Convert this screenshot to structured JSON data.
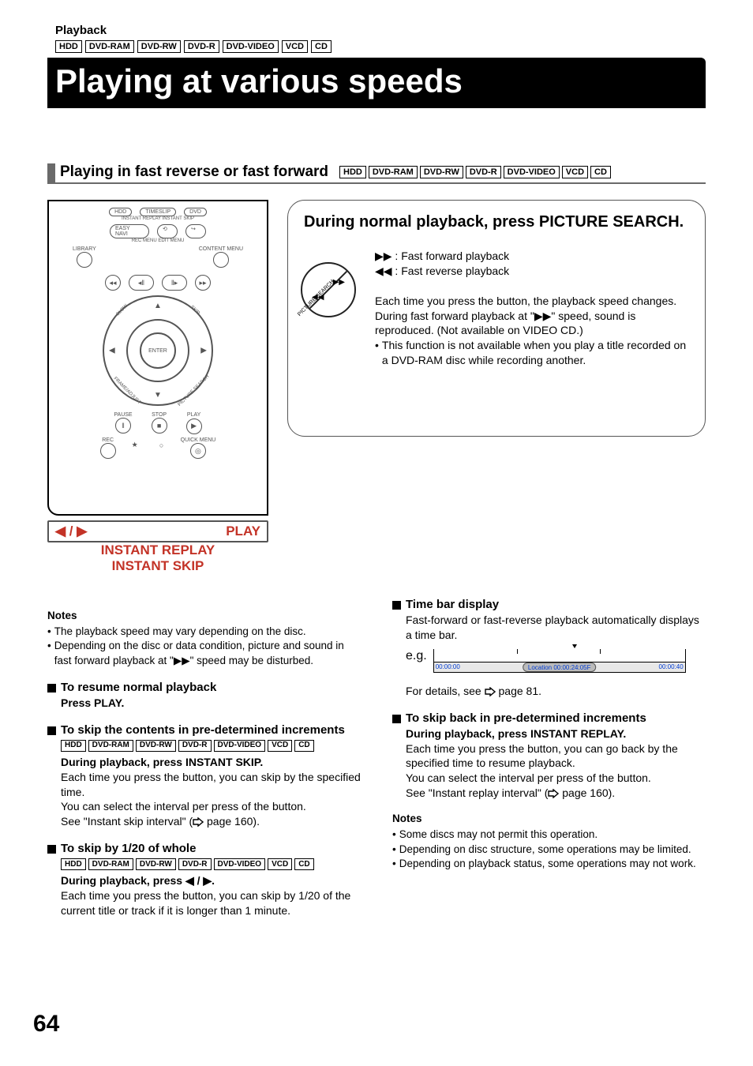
{
  "header": {
    "section": "Playback",
    "media": [
      "HDD",
      "DVD-RAM",
      "DVD-RW",
      "DVD-R",
      "DVD-VIDEO",
      "VCD",
      "CD"
    ],
    "title": "Playing at various speeds"
  },
  "subsection": {
    "title": "Playing in fast reverse or fast forward",
    "media": [
      "HDD",
      "DVD-RAM",
      "DVD-RW",
      "DVD-R",
      "DVD-VIDEO",
      "VCD",
      "CD"
    ]
  },
  "remote": {
    "top_buttons": [
      "HDD",
      "TIMESLIP",
      "DVD"
    ],
    "instant_labels": "INSTANT REPLAY  INSTANT SKIP",
    "easy": "EASY NAVI",
    "menus": "REC MENU   EDIT MENU",
    "library": "LIBRARY",
    "content": "CONTENT MENU",
    "enter": "ENTER",
    "slow": "SLOW",
    "skip": "SKIP",
    "frame": "FRAME/ADJUST",
    "picture_search": "PICTURE SEARCH",
    "pause": "PAUSE",
    "stop": "STOP",
    "play": "PLAY",
    "rec": "REC",
    "quick": "QUICK MENU",
    "below": {
      "left_arrows": "◀ / ▶",
      "play": "PLAY",
      "instant_replay": "INSTANT REPLAY",
      "instant_skip": "INSTANT SKIP"
    }
  },
  "bubble": {
    "title": "During normal playback, press PICTURE SEARCH.",
    "ff": "▶▶ : Fast forward playback",
    "fr": "◀◀ : Fast reverse playback",
    "p1": "Each time you press the button, the playback speed changes.",
    "p2a": "During fast forward playback at \"",
    "p2icon": "▶▶",
    "p2b": "\" speed, sound is reproduced. (Not available on VIDEO CD.)",
    "p3": "This function is not available when you play a title recorded on a DVD-RAM disc while recording another."
  },
  "notes1": {
    "head": "Notes",
    "n1": "The playback speed may vary depending on the disc.",
    "n2a": "Depending on the disc or data condition, picture and sound in fast forward playback at \"",
    "n2icon": "▶▶",
    "n2b": "\" speed may be disturbed."
  },
  "left": {
    "resume_head": "To resume normal playback",
    "resume_body": "Press PLAY.",
    "skip_head": "To skip the contents in pre-determined increments",
    "skip_media": [
      "HDD",
      "DVD-RAM",
      "DVD-RW",
      "DVD-R",
      "DVD-VIDEO",
      "VCD",
      "CD"
    ],
    "skip_bold": "During playback, press INSTANT SKIP.",
    "skip_b1": "Each time you press the button, you can skip by the specified time.",
    "skip_b2": "You can select the interval per press of the button.",
    "skip_b3a": "See \"Instant skip interval\" (",
    "skip_b3b": " page 160).",
    "skip20_head": "To skip by 1/20 of whole",
    "skip20_media": [
      "HDD",
      "DVD-RAM",
      "DVD-RW",
      "DVD-R",
      "DVD-VIDEO",
      "VCD",
      "CD"
    ],
    "skip20_bold": "During playback, press ◀ / ▶.",
    "skip20_body": "Each time you press the button, you can skip by 1/20 of the current title or track if it is longer than 1 minute."
  },
  "right": {
    "timebar_head": "Time bar display",
    "timebar_intro": "Fast-forward or fast-reverse playback automatically displays a time bar.",
    "eg_label": "e.g.",
    "time_left": "00:00:00",
    "loc": "Location 00:00:24:05F",
    "time_right": "00:00:40",
    "details_a": "For details, see ",
    "details_b": " page 81.",
    "skipback_head": "To skip back in pre-determined increments",
    "skipback_bold": "During playback, press INSTANT REPLAY.",
    "skipback_b1": "Each time you press the button, you can go back by the specified time to resume playback.",
    "skipback_b2": "You can select the interval per press of the button.",
    "skipback_b3a": "See \"Instant replay interval\" (",
    "skipback_b3b": " page 160).",
    "notes_head": "Notes",
    "nn1": "Some discs may not permit this operation.",
    "nn2": "Depending on disc structure, some operations may be limited.",
    "nn3": "Depending on playback status, some operations may not work."
  },
  "page_number": "64"
}
